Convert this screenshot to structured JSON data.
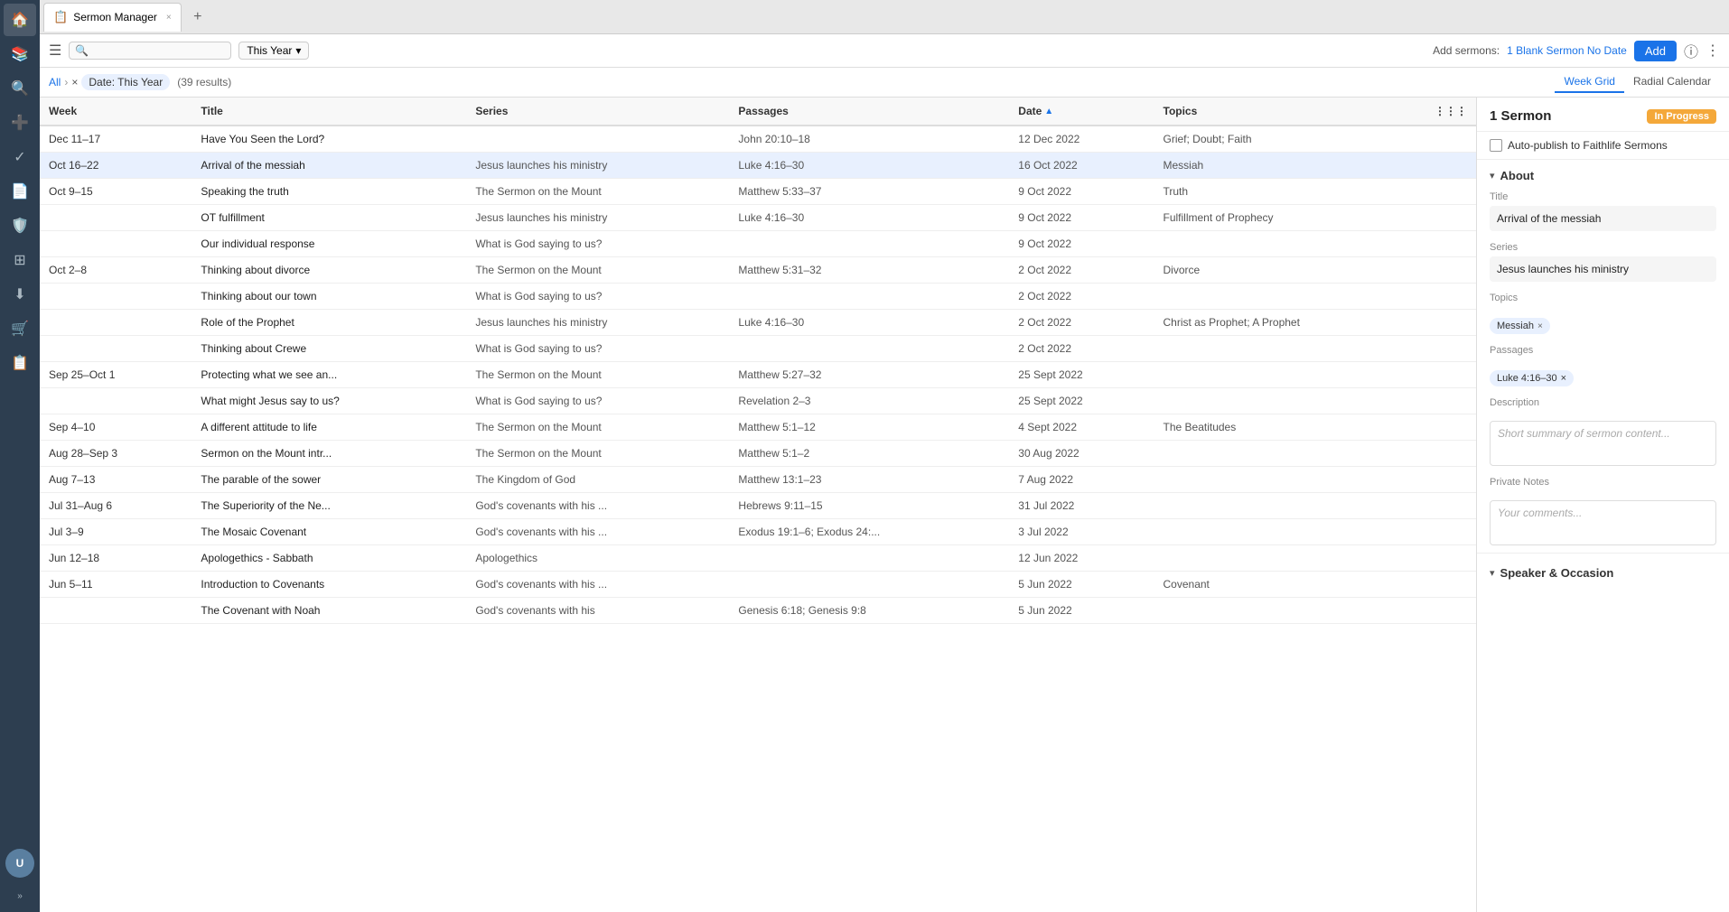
{
  "app": {
    "title": "Sermon Manager",
    "tab_icon": "📋"
  },
  "toolbar": {
    "search_placeholder": "",
    "date_filter": "This Year",
    "add_sermons_label": "Add sermons:",
    "blank_sermon_link": "1 Blank Sermon No Date",
    "add_button": "Add"
  },
  "filter_bar": {
    "all_link": "All",
    "date_filter": "Date: This Year",
    "result_count": "(39 results)",
    "view_week_grid": "Week Grid",
    "view_radial_calendar": "Radial Calendar"
  },
  "table": {
    "columns": [
      "Week",
      "Title",
      "Series",
      "Passages",
      "Date",
      "Topics"
    ],
    "rows": [
      {
        "week": "Dec 11–17",
        "title": "Have You Seen the Lord?",
        "series": "",
        "passages": "John 20:10–18",
        "date": "12 Dec 2022",
        "topics": "Grief; Doubt; Faith",
        "selected": false
      },
      {
        "week": "Oct 16–22",
        "title": "Arrival of the messiah",
        "series": "Jesus launches his ministry",
        "passages": "Luke 4:16–30",
        "date": "16 Oct 2022",
        "topics": "Messiah",
        "selected": true
      },
      {
        "week": "Oct 9–15",
        "title": "Speaking the truth",
        "series": "The Sermon on the Mount",
        "passages": "Matthew 5:33–37",
        "date": "9 Oct 2022",
        "topics": "Truth",
        "selected": false
      },
      {
        "week": "",
        "title": "OT fulfillment",
        "series": "Jesus launches his ministry",
        "passages": "Luke 4:16–30",
        "date": "9 Oct 2022",
        "topics": "Fulfillment of Prophecy",
        "selected": false
      },
      {
        "week": "",
        "title": "Our individual response",
        "series": "What is God saying to us?",
        "passages": "",
        "date": "9 Oct 2022",
        "topics": "",
        "selected": false
      },
      {
        "week": "Oct 2–8",
        "title": "Thinking about divorce",
        "series": "The Sermon on the Mount",
        "passages": "Matthew 5:31–32",
        "date": "2 Oct 2022",
        "topics": "Divorce",
        "selected": false
      },
      {
        "week": "",
        "title": "Thinking about our town",
        "series": "What is God saying to us?",
        "passages": "",
        "date": "2 Oct 2022",
        "topics": "",
        "selected": false
      },
      {
        "week": "",
        "title": "Role of the Prophet",
        "series": "Jesus launches his ministry",
        "passages": "Luke 4:16–30",
        "date": "2 Oct 2022",
        "topics": "Christ as Prophet; A Prophet",
        "selected": false
      },
      {
        "week": "",
        "title": "Thinking about Crewe",
        "series": "What is God saying to us?",
        "passages": "",
        "date": "2 Oct 2022",
        "topics": "",
        "selected": false
      },
      {
        "week": "Sep 25–Oct 1",
        "title": "Protecting what we see an...",
        "series": "The Sermon on the Mount",
        "passages": "Matthew 5:27–32",
        "date": "25 Sept 2022",
        "topics": "",
        "selected": false
      },
      {
        "week": "",
        "title": "What might Jesus say to us?",
        "series": "What is God saying to us?",
        "passages": "Revelation 2–3",
        "date": "25 Sept 2022",
        "topics": "",
        "selected": false
      },
      {
        "week": "Sep 4–10",
        "title": "A different attitude to life",
        "series": "The Sermon on the Mount",
        "passages": "Matthew 5:1–12",
        "date": "4 Sept 2022",
        "topics": "The Beatitudes",
        "selected": false
      },
      {
        "week": "Aug 28–Sep 3",
        "title": "Sermon on the Mount intr...",
        "series": "The Sermon on the Mount",
        "passages": "Matthew 5:1–2",
        "date": "30 Aug 2022",
        "topics": "",
        "selected": false
      },
      {
        "week": "Aug 7–13",
        "title": "The parable of the sower",
        "series": "The Kingdom of God",
        "passages": "Matthew 13:1–23",
        "date": "7 Aug 2022",
        "topics": "",
        "selected": false
      },
      {
        "week": "Jul 31–Aug 6",
        "title": "The Superiority of the Ne...",
        "series": "God's covenants with his ...",
        "passages": "Hebrews 9:11–15",
        "date": "31 Jul 2022",
        "topics": "",
        "selected": false
      },
      {
        "week": "Jul 3–9",
        "title": "The Mosaic Covenant",
        "series": "God's covenants with his ...",
        "passages": "Exodus 19:1–6; Exodus 24:...",
        "date": "3 Jul 2022",
        "topics": "",
        "selected": false
      },
      {
        "week": "Jun 12–18",
        "title": "Apologethics - Sabbath",
        "series": "Apologethics",
        "passages": "",
        "date": "12 Jun 2022",
        "topics": "",
        "selected": false
      },
      {
        "week": "Jun 5–11",
        "title": "Introduction to Covenants",
        "series": "God's covenants with his ...",
        "passages": "",
        "date": "5 Jun 2022",
        "topics": "Covenant",
        "selected": false
      },
      {
        "week": "",
        "title": "The Covenant with Noah",
        "series": "God's covenants with his",
        "passages": "Genesis 6:18; Genesis 9:8",
        "date": "5 Jun 2022",
        "topics": "",
        "selected": false
      }
    ]
  },
  "right_panel": {
    "sermon_count": "1 Sermon",
    "status_badge": "In Progress",
    "auto_publish_label": "Auto-publish to Faithlife Sermons",
    "sections": {
      "about": {
        "label": "About",
        "title_label": "Title",
        "title_value": "Arrival of the messiah",
        "series_label": "Series",
        "series_value": "Jesus launches his ministry",
        "topics_label": "Topics",
        "topics": [
          {
            "label": "Messiah"
          }
        ],
        "passages_label": "Passages",
        "passages": [
          {
            "label": "Luke 4:16–30"
          }
        ],
        "description_label": "Description",
        "description_placeholder": "Short summary of sermon content...",
        "private_notes_label": "Private Notes",
        "private_notes_placeholder": "Your comments..."
      },
      "speaker": {
        "label": "Speaker & Occasion"
      }
    }
  },
  "icons": {
    "hamburger": "☰",
    "search": "🔍",
    "chevron_down": "▾",
    "chevron_right": "›",
    "chevron_left": "‹",
    "close": "×",
    "plus": "+",
    "info": "ⓘ",
    "more_vert": "⋮",
    "sort_asc": "▲",
    "grid": "⊞",
    "home": "⌂",
    "books": "📚",
    "search_nav": "🔍",
    "add_nav": "➕",
    "check": "✓",
    "note": "📄",
    "shield": "🛡",
    "dots": "⠿",
    "download": "⬇",
    "cart": "🛒",
    "refresh": "↻",
    "expand": "»"
  }
}
